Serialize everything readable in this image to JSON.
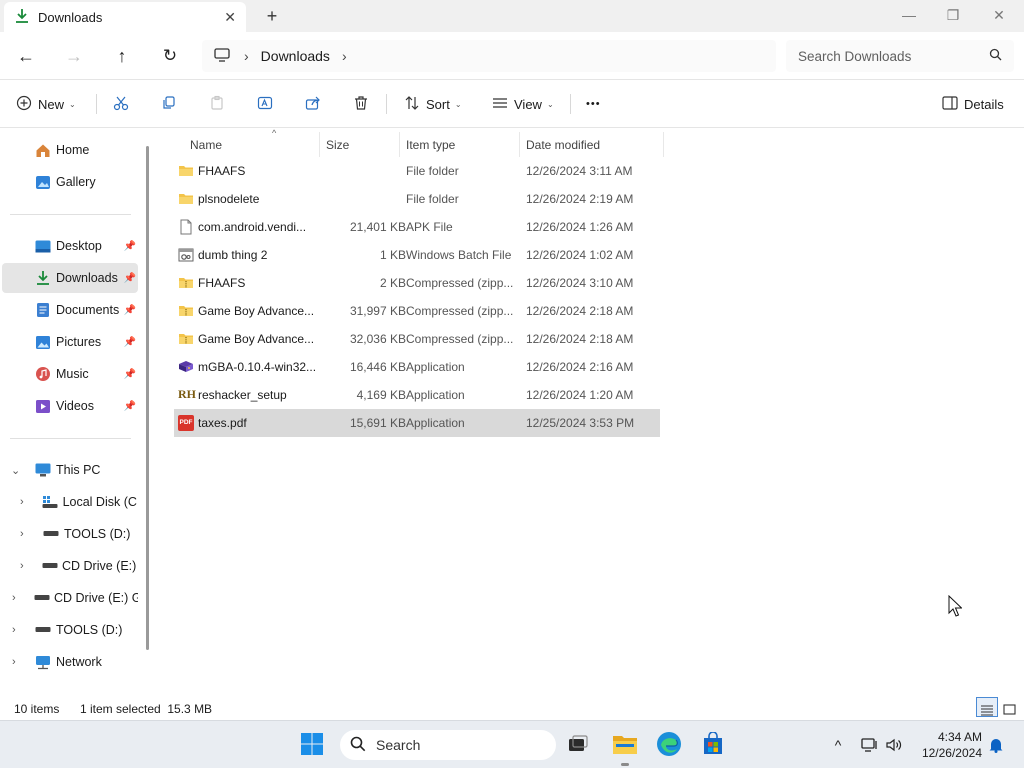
{
  "window": {
    "tab_title": "Downloads",
    "tab_close": "✕",
    "new_tab": "+",
    "minimize": "—",
    "maximize": "❐",
    "close": "✕"
  },
  "nav": {
    "back": "←",
    "forward": "→",
    "up": "↑",
    "refresh": "↻"
  },
  "address": {
    "crumb": "Downloads",
    "separator": "›"
  },
  "search": {
    "placeholder": "Search Downloads"
  },
  "commands": {
    "new_label": "New",
    "sort_label": "Sort",
    "view_label": "View",
    "more": "•••",
    "details_label": "Details",
    "caret": "⌄"
  },
  "sidebar": {
    "home": "Home",
    "gallery": "Gallery",
    "desktop": "Desktop",
    "downloads": "Downloads",
    "documents": "Documents",
    "pictures": "Pictures",
    "music": "Music",
    "videos": "Videos",
    "this_pc": "This PC",
    "local_disk": "Local Disk (C:)",
    "tools_d_sub": "TOOLS (D:)",
    "cd_drive_sub": "CD Drive (E:) G",
    "cd_drive": "CD Drive (E:) GP",
    "tools_d": "TOOLS (D:)",
    "network": "Network",
    "pin": "📌",
    "chevron_right": "›",
    "chevron_down": "⌄"
  },
  "columns": {
    "name": "Name",
    "size": "Size",
    "type": "Item type",
    "date": "Date modified",
    "sort_arrow": "^"
  },
  "files": [
    {
      "icon": "folder-icon",
      "name": "FHAAFS",
      "size": "",
      "type": "File folder",
      "date": "12/26/2024 3:11 AM"
    },
    {
      "icon": "folder-icon",
      "name": "plsnodelete",
      "size": "",
      "type": "File folder",
      "date": "12/26/2024 2:19 AM"
    },
    {
      "icon": "file-icon",
      "name": "com.android.vendi...",
      "size": "21,401 KB",
      "type": "APK File",
      "date": "12/26/2024 1:26 AM"
    },
    {
      "icon": "batch-file-icon",
      "name": "dumb thing 2",
      "size": "1 KB",
      "type": "Windows Batch File",
      "date": "12/26/2024 1:02 AM"
    },
    {
      "icon": "zip-folder-icon",
      "name": "FHAAFS",
      "size": "2 KB",
      "type": "Compressed (zipp...",
      "date": "12/26/2024 3:10 AM"
    },
    {
      "icon": "zip-folder-icon",
      "name": "Game Boy Advance...",
      "size": "31,997 KB",
      "type": "Compressed (zipp...",
      "date": "12/26/2024 2:18 AM"
    },
    {
      "icon": "zip-folder-icon",
      "name": "Game Boy Advance...",
      "size": "32,036 KB",
      "type": "Compressed (zipp...",
      "date": "12/26/2024 2:18 AM"
    },
    {
      "icon": "mgba-app-icon",
      "name": "mGBA-0.10.4-win32...",
      "size": "16,446 KB",
      "type": "Application",
      "date": "12/26/2024 2:16 AM"
    },
    {
      "icon": "reshacker-app-icon",
      "name": "reshacker_setup",
      "size": "4,169 KB",
      "type": "Application",
      "date": "12/26/2024 1:20 AM"
    },
    {
      "icon": "pdf-icon",
      "name": "taxes.pdf",
      "size": "15,691 KB",
      "type": "Application",
      "date": "12/25/2024 3:53 PM"
    }
  ],
  "icon_text": {
    "pdf": "PDF",
    "reshacker": "RH"
  },
  "status": {
    "item_count": "10 items",
    "selection": "1 item selected  15.3 MB"
  },
  "taskbar": {
    "search_placeholder": "Search",
    "tray_chevron": "^",
    "time": "4:34 AM",
    "date": "12/26/2024"
  },
  "colors": {
    "accent": "#0a62c4",
    "folder": "#f3c44a",
    "selection": "#d9d9d9"
  }
}
